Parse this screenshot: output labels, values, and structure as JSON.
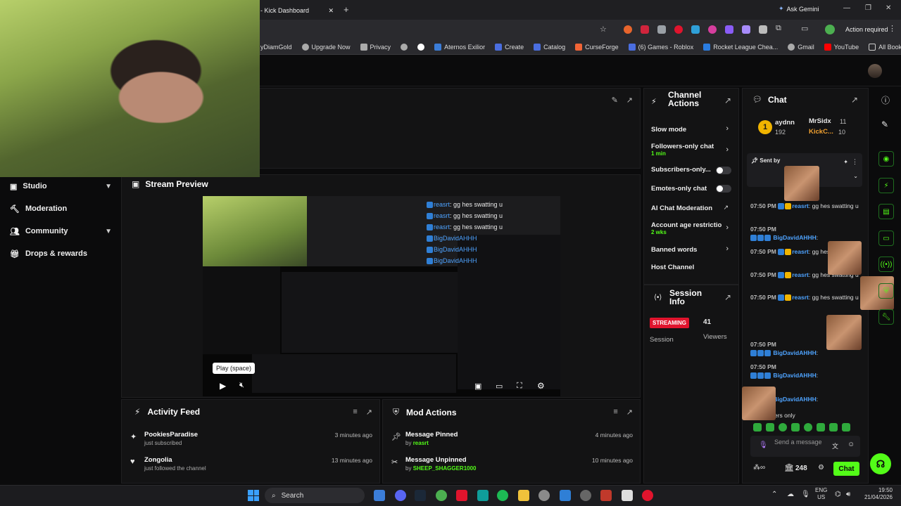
{
  "browser": {
    "tab_title": "- Kick Dashboard",
    "ask_gemini": "Ask Gemini",
    "action_required": "Action required",
    "bookmarks": [
      "yDiamGold",
      "Upgrade Now",
      "Privacy",
      "Aternos Exilior",
      "Create",
      "Catalog",
      "CurseForge",
      "(6) Games - Roblox",
      "Rocket League Chea...",
      "Gmail",
      "YouTube"
    ],
    "all_bookmarks": "All Bookmarks"
  },
  "sidebar": {
    "items": [
      {
        "label": "Studio",
        "icon": "studio-icon",
        "has_chevron": true
      },
      {
        "label": "Moderation",
        "icon": "hammer-icon",
        "has_chevron": false
      },
      {
        "label": "Community",
        "icon": "people-icon",
        "has_chevron": true
      },
      {
        "label": "Drops & rewards",
        "icon": "gift-icon",
        "has_chevron": false
      }
    ]
  },
  "stream_preview": {
    "title": "Stream Preview",
    "tooltip": "Play (space)",
    "inner_chat_lines": [
      {
        "user": "reasrt",
        "text": ": gg hes swatting u"
      },
      {
        "user": "reasrt",
        "text": ": gg hes swatting u"
      },
      {
        "user": "reasrt",
        "text": ": gg hes swatting u"
      },
      {
        "user": "BigDavidAHHH",
        "text": ""
      },
      {
        "user": "BigDavidAHHH",
        "text": ""
      },
      {
        "user": "BigDavidAHHH",
        "text": ""
      }
    ]
  },
  "channel_actions": {
    "title_line1": "Channel",
    "title_line2": "Actions",
    "items": [
      {
        "label": "Slow mode",
        "sub": "",
        "control": "chevron"
      },
      {
        "label": "Followers-only chat",
        "sub": "1 min",
        "control": "chevron"
      },
      {
        "label": "Subscribers-only...",
        "sub": "",
        "control": "toggle"
      },
      {
        "label": "Emotes-only chat",
        "sub": "",
        "control": "toggle"
      },
      {
        "label": "AI Chat Moderation",
        "sub": "",
        "control": "external"
      },
      {
        "label": "Account age restrictio",
        "sub": "2 wks",
        "control": "chevron"
      },
      {
        "label": "Banned words",
        "sub": "",
        "control": "chevron"
      },
      {
        "label": "Host Channel",
        "sub": "",
        "control": "none"
      }
    ]
  },
  "session_info": {
    "title_line1": "Session",
    "title_line2": "Info",
    "status": "STREAMING",
    "status_label": "Session",
    "viewers": "41",
    "viewers_label": "Viewers"
  },
  "chat": {
    "title": "Chat",
    "gifters": [
      {
        "name": "aydnn",
        "count": "192"
      },
      {
        "name": "MrSidx",
        "count": "11"
      },
      {
        "name": "KickC...",
        "count": "10"
      }
    ],
    "rank": "1",
    "pinned_label": "Sent by",
    "messages": [
      {
        "time": "07:50 PM",
        "user": "reasrt",
        "text": ": gg hes swatting u"
      },
      {
        "time": "07:50 PM",
        "user": "BigDavidAHHH",
        "text": ":"
      },
      {
        "time": "07:50 PM",
        "user": "reasrt",
        "text": ": gg hes swatting u"
      },
      {
        "time": "07:50 PM",
        "user": "reasrt",
        "text": ": gg hes swatting u"
      },
      {
        "time": "07:50 PM",
        "user": "reasrt",
        "text": ": gg hes swatting u"
      },
      {
        "time": "07:50 PM",
        "user": "BigDavidAHHH",
        "text": ":"
      },
      {
        "time": "07:50 PM",
        "user": "BigDavidAHHH",
        "text": ":"
      },
      {
        "time": "",
        "user": "BigDavidAHHH",
        "text": ":"
      }
    ],
    "mode_notice": "ers only",
    "input_placeholder": "Send a message",
    "points": "248",
    "send_label": "Chat"
  },
  "activity_feed": {
    "title": "Activity Feed",
    "items": [
      {
        "name": "PookiesParadise",
        "sub": "just subscribed",
        "time": "3 minutes ago",
        "icon": "sparkle-icon"
      },
      {
        "name": "Zongolia",
        "sub": "just followed the channel",
        "time": "13 minutes ago",
        "icon": "heart-icon"
      }
    ]
  },
  "mod_actions": {
    "title": "Mod Actions",
    "items": [
      {
        "action": "Message Pinned",
        "by": "by",
        "user": "reasrt",
        "time": "4 minutes ago",
        "icon": "pin-icon"
      },
      {
        "action": "Message Unpinned",
        "by": "by",
        "user": "SHEEP_SHAGGER1000",
        "time": "10 minutes ago",
        "icon": "unpin-icon"
      }
    ]
  },
  "taskbar": {
    "search": "Search",
    "lang": "ENG",
    "region": "US",
    "time": "19:50",
    "date": "21/04/2026"
  },
  "colors": {
    "accent": "#53fc18",
    "streaming": "#e0142d",
    "username": "#4ea3ff"
  }
}
